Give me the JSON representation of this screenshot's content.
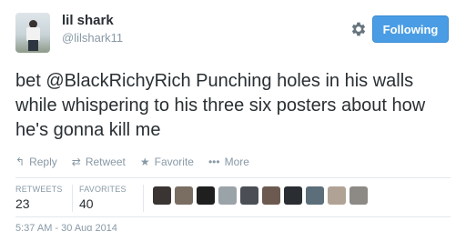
{
  "user": {
    "name": "lil shark",
    "handle": "@lilshark11"
  },
  "follow_button": {
    "label": "Following"
  },
  "tweet": {
    "prefix": "bet ",
    "mention": "@BlackRichyRich",
    "body": " Punching holes in his walls while whispering to his three six posters about how he's gonna kill me"
  },
  "actions": [
    {
      "icon": "reply-icon",
      "label": "Reply"
    },
    {
      "icon": "retweet-icon",
      "label": "Retweet"
    },
    {
      "icon": "star-icon",
      "label": "Favorite"
    },
    {
      "icon": "more-icon",
      "label": "More"
    }
  ],
  "stats": {
    "retweets_label": "RETWEETS",
    "retweets_value": "23",
    "favorites_label": "FAVORITES",
    "favorites_value": "40"
  },
  "favoriters": [
    {
      "color": "#3a3533"
    },
    {
      "color": "#7a6e62"
    },
    {
      "color": "#1f1f1f"
    },
    {
      "color": "#9aa3a8"
    },
    {
      "color": "#4b4f55"
    },
    {
      "color": "#6c5a50"
    },
    {
      "color": "#2a2e33"
    },
    {
      "color": "#5b6e7a"
    },
    {
      "color": "#b0a396"
    },
    {
      "color": "#8d8a86"
    }
  ],
  "timestamp": "5:37 AM - 30 Aug 2014",
  "colors": {
    "accent": "#4a9de4",
    "muted": "#8899a6",
    "text": "#292f33"
  }
}
